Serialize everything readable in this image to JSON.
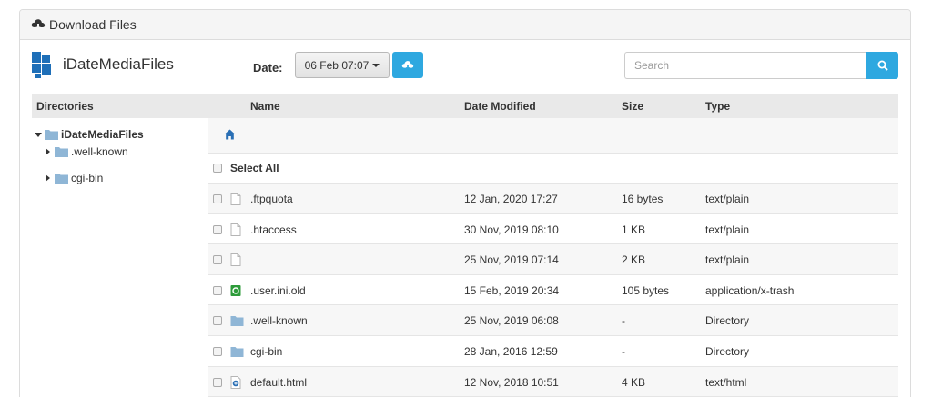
{
  "panel": {
    "title": "Download Files"
  },
  "toolbar": {
    "app_name": "iDateMediaFiles",
    "date_label": "Date:",
    "date_value": "06 Feb 07:07",
    "search_placeholder": "Search"
  },
  "directories": {
    "header": "Directories",
    "root": "iDateMediaFiles",
    "children": [
      ".well-known",
      "cgi-bin"
    ]
  },
  "files": {
    "columns": {
      "name": "Name",
      "modified": "Date Modified",
      "size": "Size",
      "type": "Type"
    },
    "select_all": "Select All",
    "rows": [
      {
        "icon": "text-file-icon",
        "name": ".ftpquota",
        "modified": "12 Jan, 2020 17:27",
        "size": "16 bytes",
        "type": "text/plain"
      },
      {
        "icon": "text-file-icon",
        "name": ".htaccess",
        "modified": "30 Nov, 2019 08:10",
        "size": "1 KB",
        "type": "text/plain"
      },
      {
        "icon": "text-file-icon",
        "name": "",
        "modified": "25 Nov, 2019 07:14",
        "size": "2 KB",
        "type": "text/plain"
      },
      {
        "icon": "trash-file-icon",
        "name": ".user.ini.old",
        "modified": "15 Feb, 2019 20:34",
        "size": "105 bytes",
        "type": "application/x-trash"
      },
      {
        "icon": "folder-icon",
        "name": ".well-known",
        "modified": "25 Nov, 2019 06:08",
        "size": "-",
        "type": "Directory"
      },
      {
        "icon": "folder-icon",
        "name": "cgi-bin",
        "modified": "28 Jan, 2016 12:59",
        "size": "-",
        "type": "Directory"
      },
      {
        "icon": "html-file-icon",
        "name": "default.html",
        "modified": "12 Nov, 2018 10:51",
        "size": "4 KB",
        "type": "text/html"
      }
    ]
  },
  "colors": {
    "accent": "#2ea8e0",
    "folder": "#8fb6d6",
    "header_bg": "#e9e9e9"
  }
}
